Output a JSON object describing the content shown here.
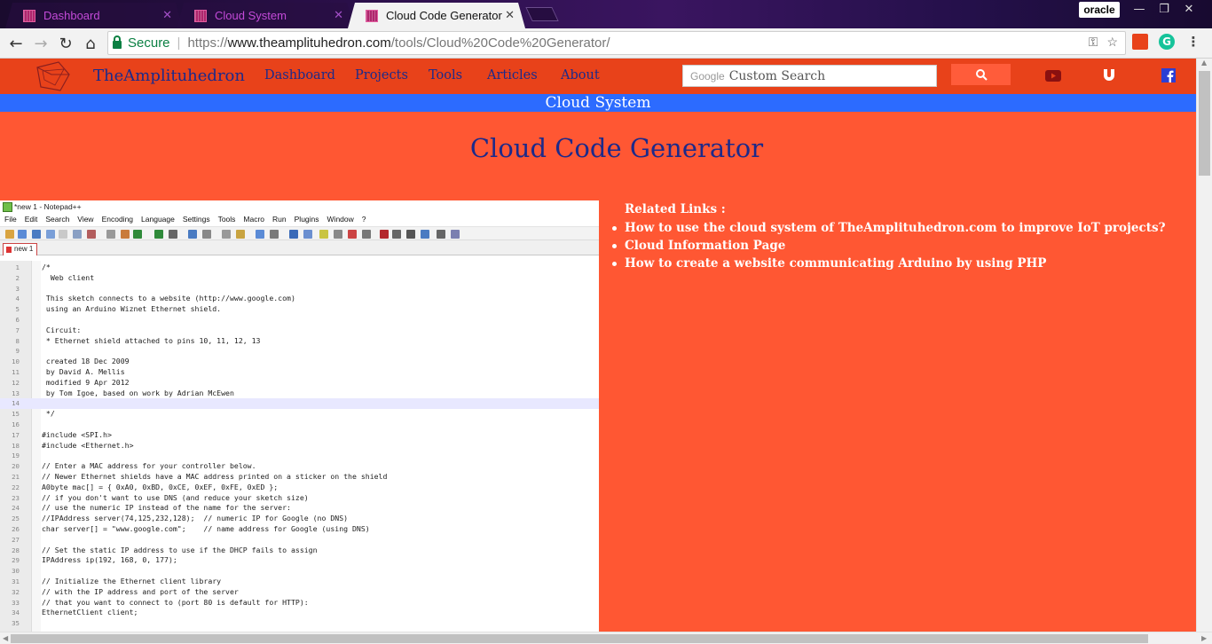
{
  "browser": {
    "tabs": [
      {
        "title": "Dashboard",
        "active": false
      },
      {
        "title": "Cloud System",
        "active": false
      },
      {
        "title": "Cloud Code Generator",
        "active": true
      }
    ],
    "profile_name": "oracle",
    "secure_label": "Secure",
    "url_scheme": "https://",
    "url_host": "www.theamplituhedron.com",
    "url_path": "/tools/Cloud%20Code%20Generator/"
  },
  "site": {
    "brand": "TheAmplituhedron",
    "nav": [
      "Dashboard",
      "Projects",
      "Tools",
      "Articles",
      "About"
    ],
    "search_brand": "Google",
    "search_placeholder": "Custom Search",
    "section_banner": "Cloud System",
    "page_title": "Cloud Code Generator"
  },
  "notepad": {
    "title": "*new 1 - Notepad++",
    "menu": [
      "File",
      "Edit",
      "Search",
      "View",
      "Encoding",
      "Language",
      "Settings",
      "Tools",
      "Macro",
      "Run",
      "Plugins",
      "Window",
      "?"
    ],
    "tab_label": "new 1",
    "lines": [
      "/*",
      "  Web client",
      "",
      " This sketch connects to a website (http://www.google.com)",
      " using an Arduino Wiznet Ethernet shield.",
      "",
      " Circuit:",
      " * Ethernet shield attached to pins 10, 11, 12, 13",
      "",
      " created 18 Dec 2009",
      " by David A. Mellis",
      " modified 9 Apr 2012",
      " by Tom Igoe, based on work by Adrian McEwen",
      "",
      " */",
      "",
      "#include <SPI.h>",
      "#include <Ethernet.h>",
      "",
      "// Enter a MAC address for your controller below.",
      "// Newer Ethernet shields have a MAC address printed on a sticker on the shield",
      "A0byte mac[] = { 0xA0, 0xBD, 0xCE, 0xEF, 0xFE, 0xED };",
      "// if you don't want to use DNS (and reduce your sketch size)",
      "// use the numeric IP instead of the name for the server:",
      "//IPAddress server(74,125,232,128);  // numeric IP for Google (no DNS)",
      "char server[] = \"www.google.com\";    // name address for Google (using DNS)",
      "",
      "// Set the static IP address to use if the DHCP fails to assign",
      "IPAddress ip(192, 168, 0, 177);",
      "",
      "// Initialize the Ethernet client library",
      "// with the IP address and port of the server",
      "// that you want to connect to (port 80 is default for HTTP):",
      "EthernetClient client;",
      "",
      ""
    ],
    "current_line": 14
  },
  "related": {
    "heading": "Related Links :",
    "links": [
      "How to use the cloud system of TheAmplituhedron.com to improve IoT projects?",
      "Cloud Information Page",
      "How to create a website communicating Arduino by using PHP"
    ]
  },
  "colors": {
    "page_bg": "#ff5733",
    "nav_bg": "#e8421a",
    "banner_bg": "#2c6bff",
    "brand_text": "#1c2a8a"
  }
}
